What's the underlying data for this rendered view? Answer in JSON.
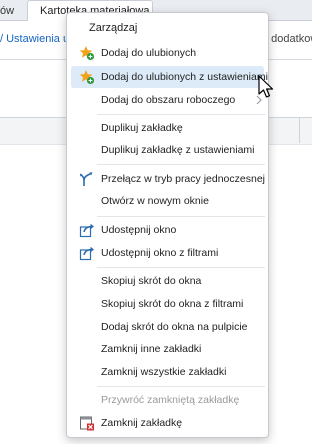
{
  "tabs": {
    "previous": "ów",
    "active": "Kartoteka materiałowa"
  },
  "toolbar": {
    "left": "/ Ustawienia uż",
    "right": "e dodatkow"
  },
  "menu": {
    "header": "Zarządzaj",
    "items": [
      {
        "label": "Dodaj do ulubionych",
        "icon": "star-add-icon"
      },
      {
        "label": "Dodaj do ulubionych z ustawieniami",
        "icon": "star-add-icon",
        "highlighted": true
      },
      {
        "label": "Dodaj do obszaru roboczego",
        "submenu": true
      },
      {
        "label": "Duplikuj zakładkę"
      },
      {
        "label": "Duplikuj zakładkę z ustawieniami"
      },
      {
        "label": "Przełącz w tryb pracy jednoczesnej",
        "icon": "split-arrows-icon"
      },
      {
        "label": "Otwórz w nowym oknie"
      },
      {
        "label": "Udostępnij okno",
        "icon": "share-icon"
      },
      {
        "label": "Udostępnij okno z filtrami",
        "icon": "share-icon"
      },
      {
        "label": "Skopiuj skrót do okna"
      },
      {
        "label": "Skopiuj skrót do okna z filtrami"
      },
      {
        "label": "Dodaj skrót do okna na pulpicie"
      },
      {
        "label": "Zamknij inne zakładki"
      },
      {
        "label": "Zamknij wszystkie zakładki"
      },
      {
        "label": "Przywróć zamkniętą zakładkę",
        "disabled": true
      },
      {
        "label": "Zamknij zakładkę",
        "icon": "close-tab-icon"
      }
    ]
  },
  "colors": {
    "highlight": "#dcebf7",
    "star": "#f2a21b",
    "plus": "#2e9a3e",
    "icon_blue": "#2b6cb0",
    "close_red": "#d32f2f"
  }
}
